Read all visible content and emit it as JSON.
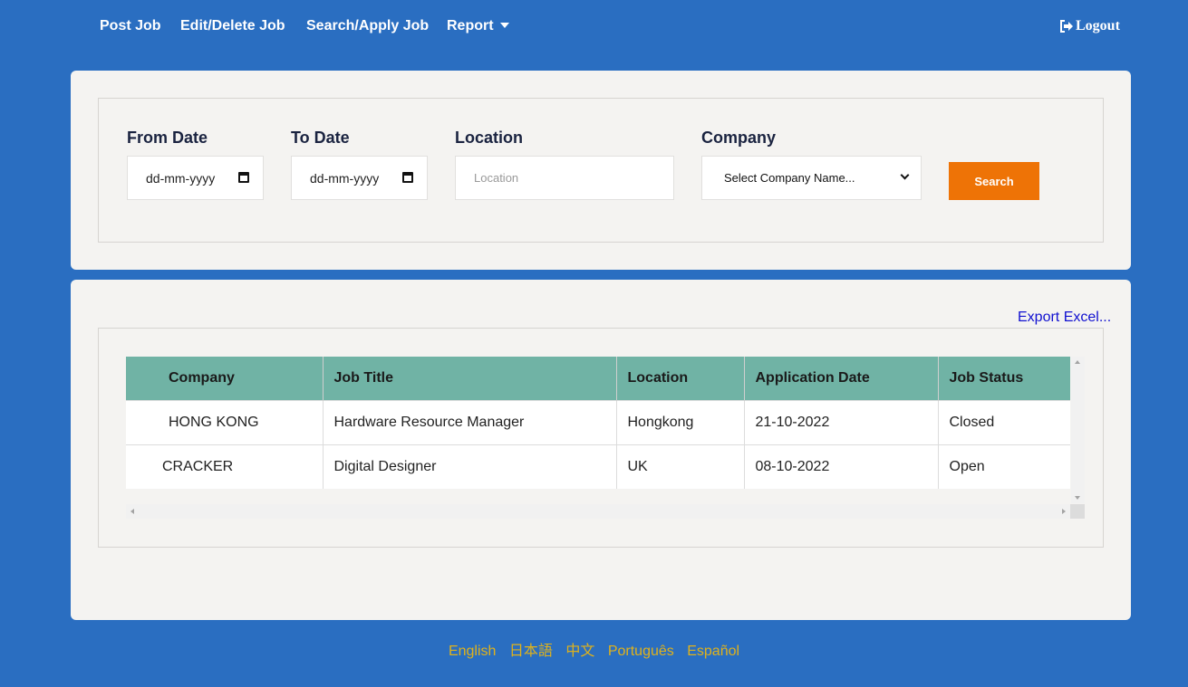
{
  "nav": {
    "post_job": "Post Job",
    "edit_delete_job": "Edit/Delete Job",
    "search_apply_job": "Search/Apply Job",
    "report": "Report",
    "logout": "Logout"
  },
  "filters": {
    "from_date_label": "From Date",
    "from_date_value": "dd-mm-yyyy",
    "to_date_label": "To Date",
    "to_date_value": "dd-mm-yyyy",
    "location_label": "Location",
    "location_placeholder": "Location",
    "company_label": "Company",
    "company_selected": "Select Company Name...",
    "search_button": "Search"
  },
  "results": {
    "export_link": "Export Excel...",
    "columns": [
      "Company",
      "Job Title",
      "Location",
      "Application Date",
      "Job Status"
    ],
    "rows": [
      [
        "HONG KONG",
        "Hardware Resource Manager",
        "Hongkong",
        "21-10-2022",
        "Closed"
      ],
      [
        "CRACKER",
        "Digital Designer",
        "UK",
        "08-10-2022",
        "Open"
      ]
    ]
  },
  "languages": [
    "English",
    "日本語",
    "中文",
    "Português",
    "Español"
  ],
  "colors": {
    "background": "#2a6ec1",
    "panel": "#f4f3f1",
    "table_header": "#70b3a5",
    "search_button": "#ee7306",
    "footer_links": "#e0b21b",
    "export_link": "#1010d0"
  }
}
